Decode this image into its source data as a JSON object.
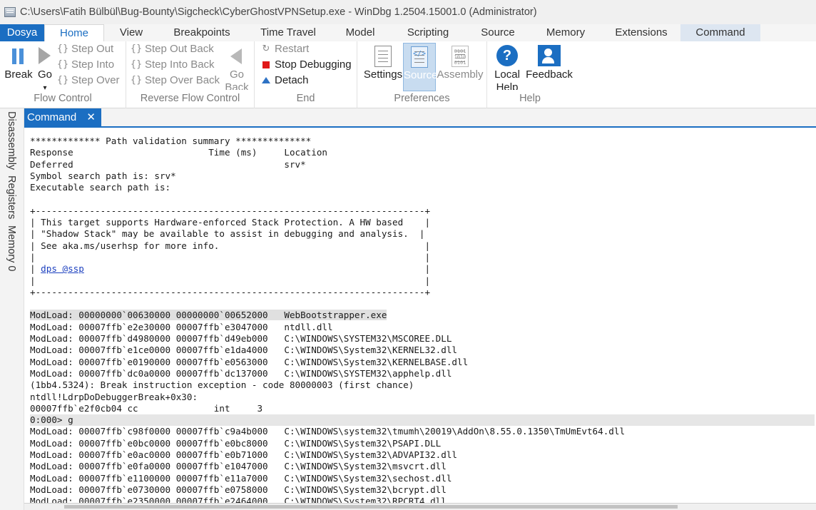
{
  "window": {
    "title": "C:\\Users\\Fatih Bülbül\\Bug-Bounty\\Sigcheck\\CyberGhostVPNSetup.exe - WinDbg 1.2504.15001.0 (Administrator)"
  },
  "tabs": [
    "Dosya",
    "Home",
    "View",
    "Breakpoints",
    "Time Travel",
    "Model",
    "Scripting",
    "Source",
    "Memory",
    "Extensions",
    "Command"
  ],
  "ribbon": {
    "flow_control": {
      "label": "Flow Control",
      "break": "Break",
      "go": "Go",
      "step_out": "Step Out",
      "step_into": "Step Into",
      "step_over": "Step Over"
    },
    "reverse_flow_control": {
      "label": "Reverse Flow Control",
      "step_out_back": "Step Out Back",
      "step_into_back": "Step Into Back",
      "step_over_back": "Step Over Back",
      "go_back_line1": "Go",
      "go_back_line2": "Back"
    },
    "end": {
      "label": "End",
      "restart": "Restart",
      "stop_debugging": "Stop Debugging",
      "detach": "Detach"
    },
    "preferences": {
      "label": "Preferences",
      "settings": "Settings",
      "source": "Source",
      "assembly": "Assembly"
    },
    "help": {
      "label": "Help",
      "local_help_line1": "Local",
      "local_help_line2": "Help",
      "feedback": "Feedback"
    }
  },
  "sidebar": [
    "Disassembly",
    "Registers",
    "Memory 0"
  ],
  "command_window": {
    "tab_label": "Command",
    "close_glyph": "✕",
    "lines": [
      "************* Path validation summary **************",
      "Response                         Time (ms)     Location",
      "Deferred                                       srv*",
      "Symbol search path is: srv*",
      "Executable search path is:",
      "",
      "+------------------------------------------------------------------------+",
      "| This target supports Hardware-enforced Stack Protection. A HW based    |",
      "| \"Shadow Stack\" may be available to assist in debugging and analysis.  |",
      "| See aka.ms/userhsp for more info.                                      |",
      "|                                                                        |",
      "| ",
      "|                                                                        |",
      "+------------------------------------------------------------------------+",
      "",
      "ModLoad: 00000000`00630000 00000000`00652000   WebBootstrapper.exe",
      "ModLoad: 00007ffb`e2e30000 00007ffb`e3047000   ntdll.dll",
      "ModLoad: 00007ffb`d4980000 00007ffb`d49eb000   C:\\WINDOWS\\SYSTEM32\\MSCOREE.DLL",
      "ModLoad: 00007ffb`e1ce0000 00007ffb`e1da4000   C:\\WINDOWS\\System32\\KERNEL32.dll",
      "ModLoad: 00007ffb`e0190000 00007ffb`e0563000   C:\\WINDOWS\\System32\\KERNELBASE.dll",
      "ModLoad: 00007ffb`dc0a0000 00007ffb`dc137000   C:\\WINDOWS\\SYSTEM32\\apphelp.dll",
      "(1bb4.5324): Break instruction exception - code 80000003 (first chance)",
      "ntdll!LdrpDoDebuggerBreak+0x30:",
      "00007ffb`e2f0cb04 cc              int     3",
      "0:000> g",
      "ModLoad: 00007ffb`c98f0000 00007ffb`c9a4b000   C:\\WINDOWS\\system32\\tmumh\\20019\\AddOn\\8.55.0.1350\\TmUmEvt64.dll",
      "ModLoad: 00007ffb`e0bc0000 00007ffb`e0bc8000   C:\\WINDOWS\\System32\\PSAPI.DLL",
      "ModLoad: 00007ffb`e0ac0000 00007ffb`e0b71000   C:\\WINDOWS\\System32\\ADVAPI32.dll",
      "ModLoad: 00007ffb`e0fa0000 00007ffb`e1047000   C:\\WINDOWS\\System32\\msvcrt.dll",
      "ModLoad: 00007ffb`e1100000 00007ffb`e11a7000   C:\\WINDOWS\\System32\\sechost.dll",
      "ModLoad: 00007ffb`e0730000 00007ffb`e0758000   C:\\WINDOWS\\System32\\bcrypt.dll",
      "ModLoad: 00007ffb`e2350000 00007ffb`e2464000   C:\\WINDOWS\\System32\\RPCRT4.dll"
    ],
    "link_text": "dps @ssp",
    "link_line_suffix": "                                                               |"
  }
}
